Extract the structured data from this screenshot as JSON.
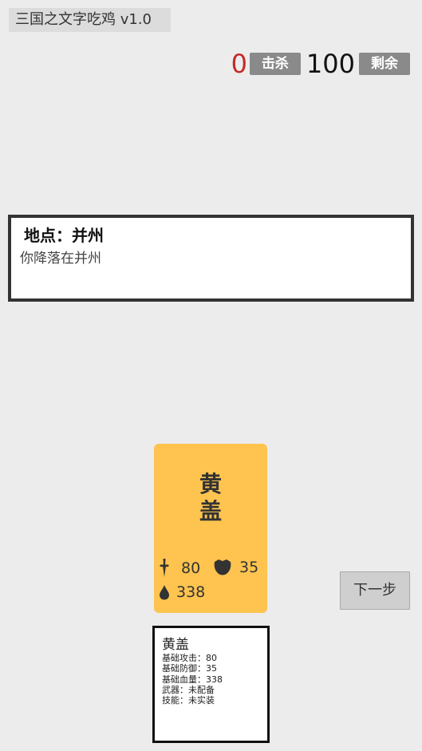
{
  "app": {
    "title": "三国之文字吃鸡 v1.0"
  },
  "stats": {
    "kills": "0",
    "kills_label": "击杀",
    "remaining": "100",
    "remaining_label": "剩余"
  },
  "location": {
    "title": "地点：并州",
    "log": "你降落在并州"
  },
  "card": {
    "name_chars": [
      "黄",
      "盖"
    ],
    "attack": "80",
    "defense": "35",
    "hp": "338",
    "icons": {
      "attack": "sword-icon",
      "defense": "shield-icon",
      "hp": "blood-drop-icon"
    },
    "color": "#fec44f"
  },
  "controls": {
    "next_label": "下一步"
  },
  "info": {
    "name": "黄盖",
    "lines": [
      "基础攻击：80",
      "基础防御：35",
      "基础血量：338",
      "武器：未配备",
      "技能：未实装"
    ]
  },
  "colors": {
    "kills_text": "#c62828",
    "badge_bg": "#8a8a8a",
    "background": "#ececec"
  }
}
